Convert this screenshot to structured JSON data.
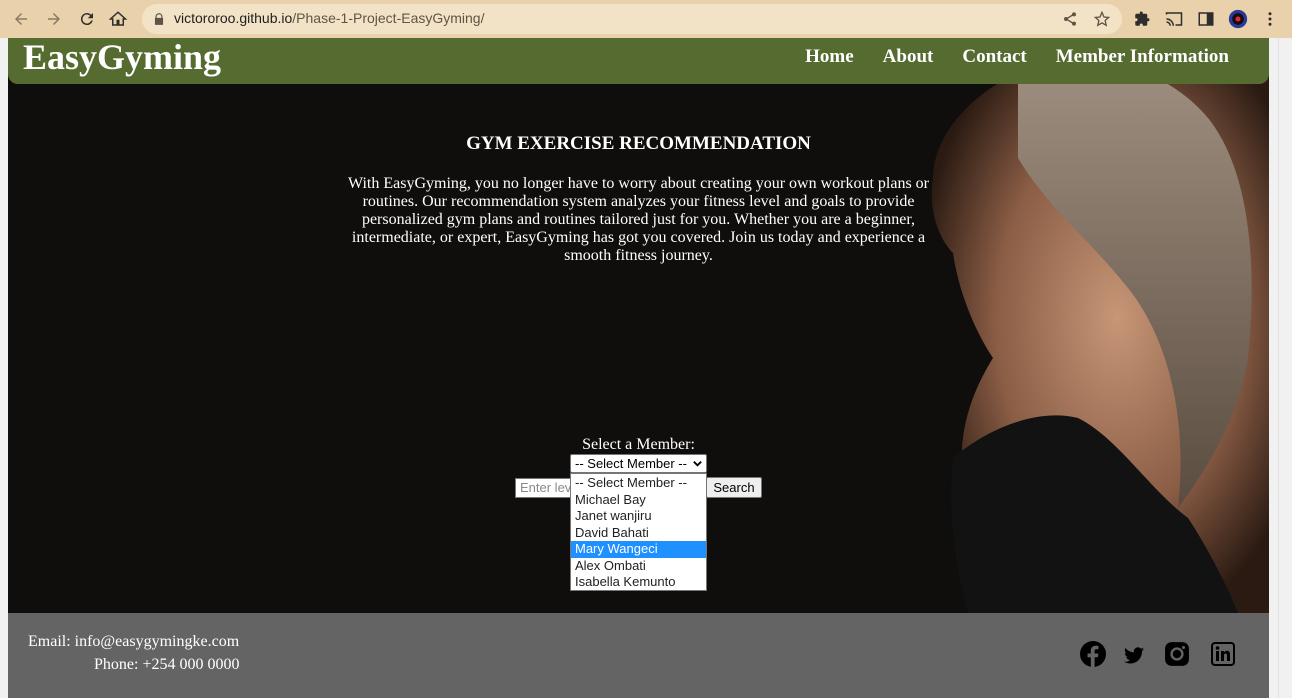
{
  "browser": {
    "url_host": "victororoo.github.io",
    "url_path": "/Phase-1-Project-EasyGyming/"
  },
  "header": {
    "brand": "EasyGyming",
    "nav": [
      "Home",
      "About",
      "Contact",
      "Member Information"
    ]
  },
  "hero": {
    "title": "GYM EXERCISE RECOMMENDATION",
    "intro": "With EasyGyming, you no longer have to worry about creating your own workout plans or routines. Our recommendation system analyzes your fitness level and goals to provide personalized gym plans and routines tailored just for you. Whether you are a beginner, intermediate, or expert, EasyGyming has got you covered. Join us today and experience a smooth fitness journey."
  },
  "member_form": {
    "label": "Select a Member:",
    "selected": "-- Select Member --",
    "options": [
      "-- Select Member --",
      "Michael Bay",
      "Janet wanjiru",
      "David Bahati",
      "Mary Wangeci",
      "Alex Ombati",
      "Isabella Kemunto"
    ],
    "highlighted_index": 4,
    "level_placeholder": "Enter lev",
    "search_label": "Search"
  },
  "footer": {
    "email": "Email: info@easygymingke.com",
    "phone": "Phone: +254 000 0000",
    "social": [
      "facebook-icon",
      "twitter-icon",
      "instagram-icon",
      "linkedin-icon"
    ]
  },
  "colors": {
    "header_bg": "#556b2f",
    "footer_bg": "#646464",
    "browser_bar": "#e9d2ab",
    "highlight": "#1e90ff"
  }
}
